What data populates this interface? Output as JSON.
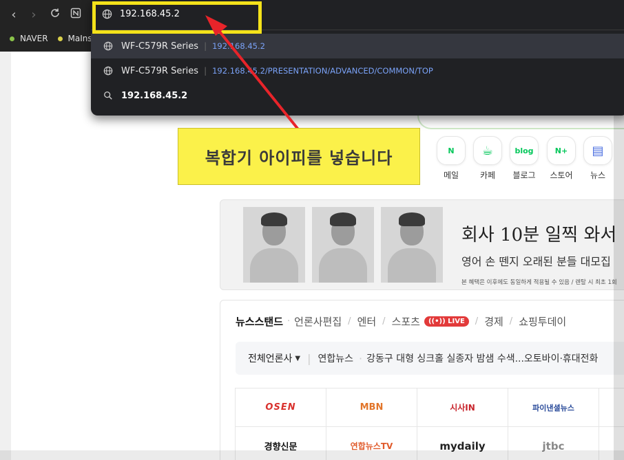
{
  "browser": {
    "bookmarks": [
      {
        "label": "NAVER",
        "color": "#8ac34a"
      },
      {
        "label": "MaInst",
        "color": "#d9d04a"
      }
    ]
  },
  "omnibox": {
    "value": "192.168.45.2",
    "suggestions": [
      {
        "title": "WF-C579R Series",
        "url": "192.168.45.2",
        "icon": "globe-icon",
        "selected": true
      },
      {
        "title": "WF-C579R Series",
        "url": "192.168.45.2/PRESENTATION/ADVANCED/COMMON/TOP",
        "icon": "globe-icon",
        "selected": false
      },
      {
        "query": "192.168.45.2",
        "icon": "search-icon"
      }
    ]
  },
  "annotation": {
    "callout_text": "복합기 아이피를 넣습니다",
    "highlight_color": "#f4e21a",
    "arrow_color": "#e8242a"
  },
  "naver": {
    "services": [
      {
        "label": "메일",
        "icon": "naver-mail-icon",
        "glyph": "N"
      },
      {
        "label": "카페",
        "icon": "cafe-cup-icon",
        "glyph": "☕"
      },
      {
        "label": "블로그",
        "icon": "blog-icon",
        "glyph": "blog"
      },
      {
        "label": "스토어",
        "icon": "store-icon",
        "glyph": "N+"
      },
      {
        "label": "뉴스",
        "icon": "news-icon",
        "glyph": "▤"
      }
    ],
    "ad": {
      "title": "회사 10분 일찍 와서",
      "subtitle": "영어 손 뗀지 오래된 분들 대모집",
      "note": "본 혜택은 이후에도 동일하게 적용될 수 있음 / 렌탈 시 최초 1회"
    },
    "news": {
      "tabs": [
        "뉴스스탠드",
        "언론사편집",
        "엔터",
        "스포츠",
        "경제",
        "쇼핑투데이"
      ],
      "live_badge": "LIVE",
      "ticker": {
        "select_label": "전체언론사",
        "source": "연합뉴스",
        "headline": "강동구 대형 싱크홀 실종자 밤샘 수색...오토바이·휴대전화"
      },
      "press_row1": [
        {
          "name": "OSEN",
          "color": "#d9322e"
        },
        {
          "name": "MBN",
          "color": "#e2752a"
        },
        {
          "name": "시사IN",
          "color": "#c8252c"
        },
        {
          "name": "파이낸셜뉴스",
          "color": "#2a4b9a"
        }
      ],
      "press_row2": [
        {
          "name": "경향신문",
          "color": "#111111"
        },
        {
          "name": "연합뉴스TV",
          "color": "#e05a2a"
        },
        {
          "name": "mydaily",
          "color": "#222222"
        },
        {
          "name": "jtbc",
          "color": "#888888"
        }
      ]
    }
  }
}
